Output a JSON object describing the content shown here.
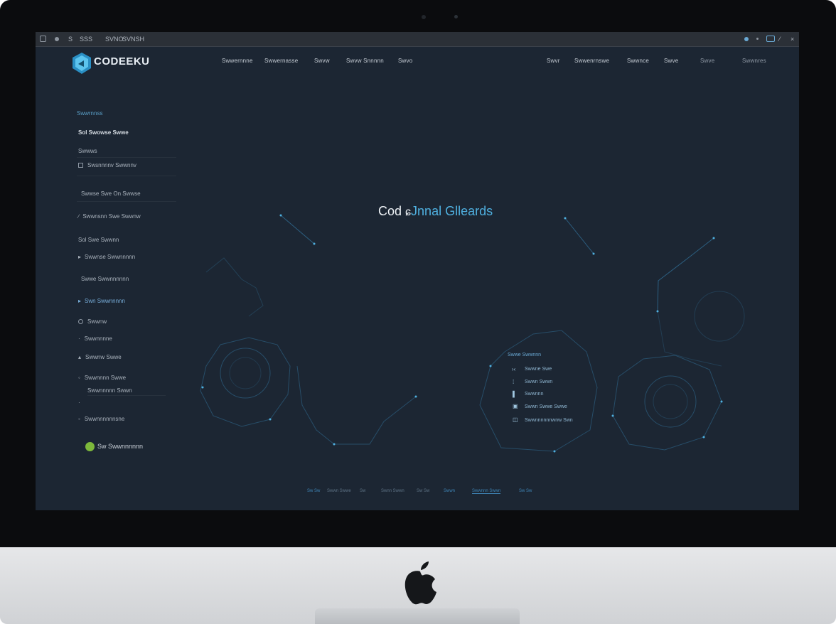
{
  "app": {
    "logo_text": "CODEEKU",
    "hero_white": "Cod",
    "hero_mid": " ",
    "hero_blue_1": "Jnnal",
    "hero_blue_2": " Glleards"
  },
  "system_bar": {
    "items": [
      "S",
      "SSS",
      "SVNO",
      "SVNSH"
    ]
  },
  "nav": {
    "left": [
      "Swwernnne",
      "Swwernasse",
      "Swvw",
      "Swvw Snnnnn",
      "Swvo"
    ],
    "right": [
      "Swvr",
      "Swwenrnswe",
      "Swwnce",
      "Swve",
      "Swve",
      "Swwnres"
    ]
  },
  "sidebar": {
    "items": [
      "Swwrnnss",
      "Sol Swowse Swwe",
      "Swwws",
      "Swsnnnnv Swwnnv",
      "Swwse Swe On Swwse",
      "Swwnsnn Swe Swwnw",
      "Sol Swe Swwnn",
      "Swwnse Swwnnnnn",
      "Swwe Swwnnnnnn",
      "Swn Swwnnnnn",
      "Swwnw",
      "Swwnnnne",
      "Swwnw Swwe",
      "Swwnnnn Swwe",
      "Swwnnnnn Swwn",
      "Swwnnnnnnsne"
    ],
    "status_label": "Sw Swwnnnnnn"
  },
  "card": {
    "title": "Swwe Swwnnn",
    "rows": [
      "Swwne Swe",
      "Swwn Swwn",
      "Swwnnn",
      "Swwn Swwe Swwe",
      "Swwnnnnnnwnw Swn"
    ]
  },
  "footer": {
    "items": [
      "Sw Sw",
      "Swwn Swwe",
      "Sw",
      "Swnn Swwn",
      "Sw Sw",
      "Swwn",
      "Swwnnn Swwn",
      "Sw Sw"
    ]
  },
  "colors": {
    "screen_bg": "#1c2633",
    "accent": "#4fb0e0",
    "status": "#7db83b"
  },
  "icons": [
    "apple-logo-icon",
    "codeeku-logo-icon",
    "settings-icon",
    "window-icon"
  ]
}
